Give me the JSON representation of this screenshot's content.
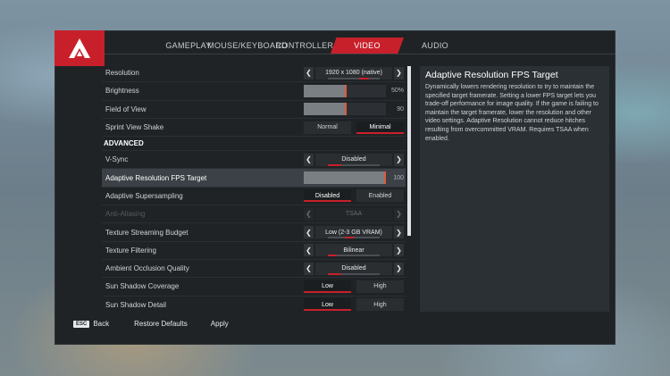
{
  "tabs": [
    {
      "label": "GAMEPLAY",
      "active": false
    },
    {
      "label": "MOUSE/KEYBOARD",
      "active": false
    },
    {
      "label": "CONTROLLER",
      "active": false
    },
    {
      "label": "VIDEO",
      "active": true
    },
    {
      "label": "AUDIO",
      "active": false
    }
  ],
  "settings": {
    "resolution": {
      "label": "Resolution",
      "value": "1920 x 1080 (native)"
    },
    "brightness": {
      "label": "Brightness",
      "value": "50%",
      "level": 0.5
    },
    "fov": {
      "label": "Field of View",
      "value": "90",
      "level": 0.5
    },
    "sprint_view_shake": {
      "label": "Sprint View Shake",
      "options": [
        "Normal",
        "Minimal"
      ],
      "selected": "Minimal"
    },
    "advanced_header": "ADVANCED",
    "vsync": {
      "label": "V-Sync",
      "value": "Disabled"
    },
    "adaptive_fps": {
      "label": "Adaptive Resolution FPS Target",
      "value": "100",
      "level": 1.0
    },
    "adaptive_ss": {
      "label": "Adaptive Supersampling",
      "options": [
        "Disabled",
        "Enabled"
      ],
      "selected": "Disabled"
    },
    "anti_aliasing": {
      "label": "Anti-Aliasing",
      "value": "TSAA"
    },
    "texture_budget": {
      "label": "Texture Streaming Budget",
      "value": "Low (2-3 GB VRAM)"
    },
    "texture_filtering": {
      "label": "Texture Filtering",
      "value": "Bilinear"
    },
    "ambient_occlusion": {
      "label": "Ambient Occlusion Quality",
      "value": "Disabled"
    },
    "sun_shadow_coverage": {
      "label": "Sun Shadow Coverage",
      "options": [
        "Low",
        "High"
      ],
      "selected": "Low"
    },
    "sun_shadow_detail": {
      "label": "Sun Shadow Detail",
      "options": [
        "Low",
        "High"
      ],
      "selected": "Low"
    }
  },
  "description": {
    "title": "Adaptive Resolution FPS Target",
    "body": "Dynamically lowers rendering resolution to try to maintain the specified target framerate. Setting a lower FPS target lets you trade-off performance for image quality. If the game is failing to maintain the target framerate, lower the resolution and other video settings. Adaptive Resolution cannot reduce hitches resulting from overcommitted VRAM. Requires TSAA when enabled."
  },
  "footer": {
    "esc_key": "ESC",
    "back": "Back",
    "restore": "Restore Defaults",
    "apply": "Apply"
  },
  "colors": {
    "accent": "#c8202b",
    "panel": "#1f2326"
  }
}
